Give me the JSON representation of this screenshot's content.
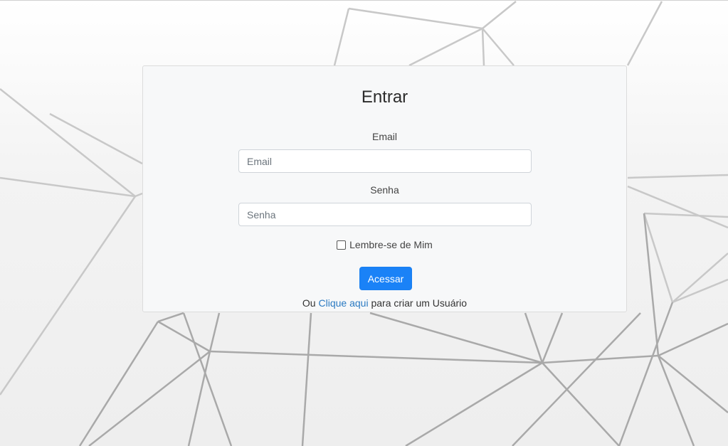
{
  "login": {
    "title": "Entrar",
    "email_label": "Email",
    "email_placeholder": "Email",
    "email_value": "",
    "password_label": "Senha",
    "password_placeholder": "Senha",
    "password_value": "",
    "remember_label": "Lembre-se de Mim",
    "remember_checked": false,
    "submit_label": "Acessar",
    "signup_prefix": "Ou",
    "signup_link": "Clique aqui",
    "signup_suffix": "para criar um Usuário"
  },
  "colors": {
    "primary_button": "#1a82f7",
    "link": "#2a7ac2",
    "card_background": "#f7f8f9",
    "background_lines": "#a8a8a8"
  }
}
